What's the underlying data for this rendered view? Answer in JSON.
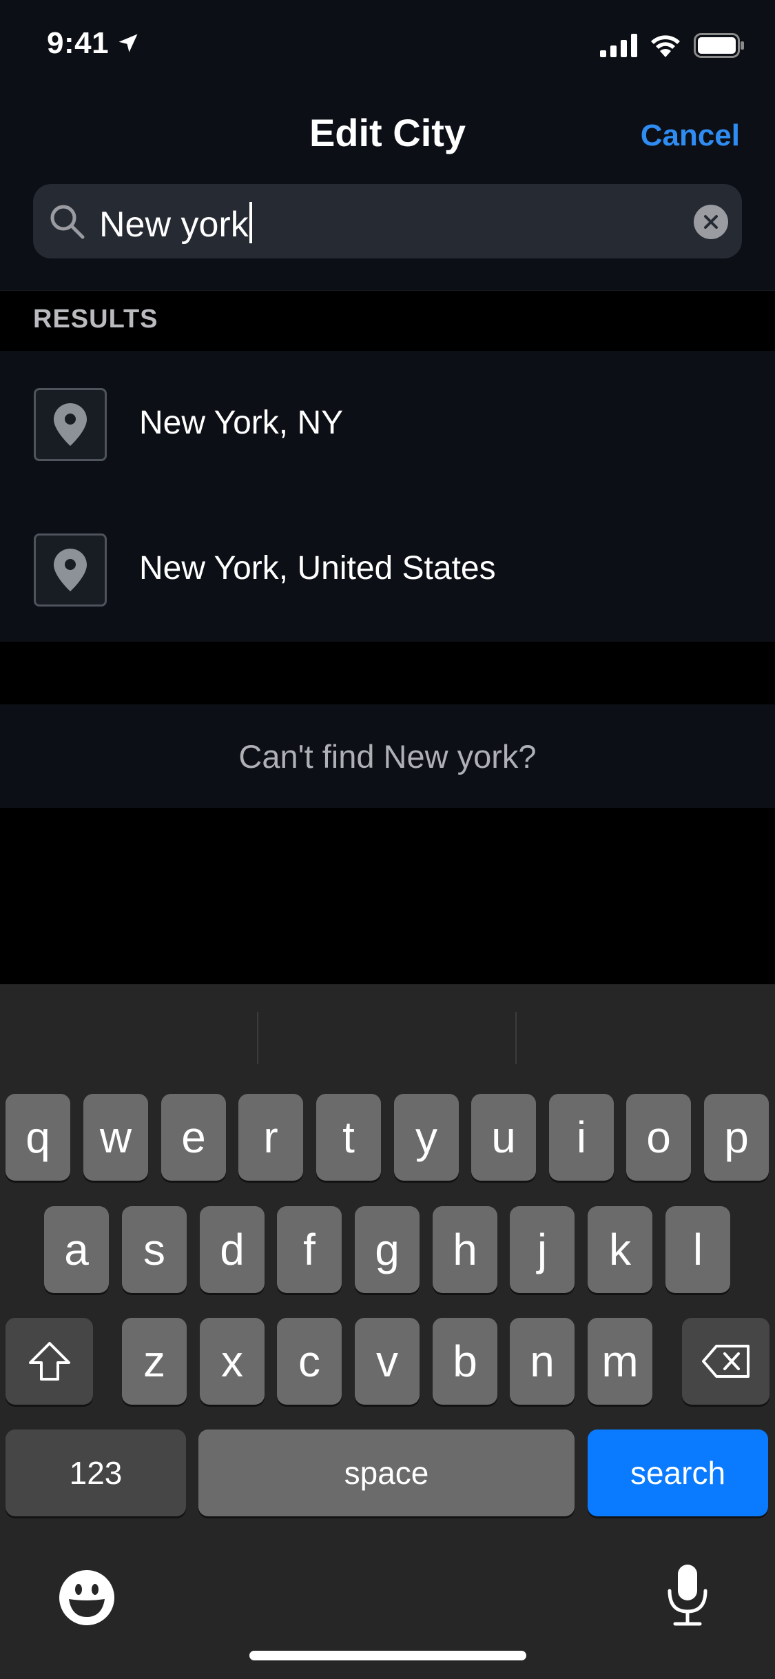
{
  "status_bar": {
    "time": "9:41",
    "icons": [
      "location-arrow-icon",
      "cellular-signal-icon",
      "wifi-icon",
      "battery-icon"
    ]
  },
  "nav": {
    "title": "Edit City",
    "cancel_label": "Cancel",
    "accent_color": "#2f8cf2"
  },
  "search": {
    "value": "New york",
    "icons": [
      "search-icon",
      "clear-icon"
    ]
  },
  "results": {
    "header": "RESULTS",
    "items": [
      {
        "label": "New York, NY",
        "icon": "location-pin-icon"
      },
      {
        "label": "New York, United States",
        "icon": "location-pin-icon"
      }
    ]
  },
  "cant_find": {
    "label": "Can't find New york?"
  },
  "keyboard": {
    "row1": [
      "q",
      "w",
      "e",
      "r",
      "t",
      "y",
      "u",
      "i",
      "o",
      "p"
    ],
    "row2": [
      "a",
      "s",
      "d",
      "f",
      "g",
      "h",
      "j",
      "k",
      "l"
    ],
    "row3": [
      "z",
      "x",
      "c",
      "v",
      "b",
      "n",
      "m"
    ],
    "numbers_label": "123",
    "space_label": "space",
    "search_label": "search",
    "search_color": "#0a7aff",
    "icons": [
      "shift-icon",
      "delete-icon",
      "emoji-icon",
      "microphone-icon"
    ]
  }
}
